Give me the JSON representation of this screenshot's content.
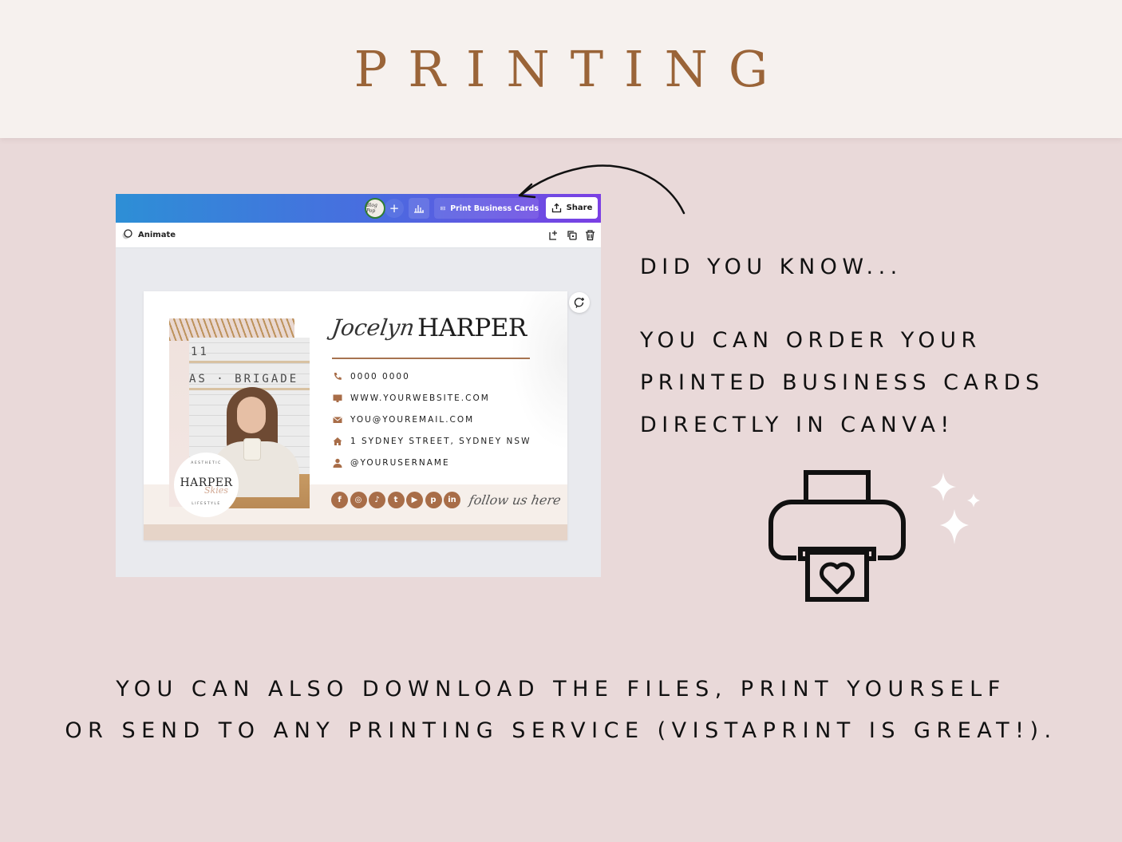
{
  "page": {
    "title": "PRINTING",
    "colors": {
      "header_bg": "#f6f1ee",
      "page_bg": "#e9d9d9",
      "title_color": "#9a6438",
      "accent_brown": "#a86d48",
      "canva_gradient_start": "#2d8fd6",
      "canva_gradient_end": "#7b3fe4"
    }
  },
  "canva": {
    "avatar_label": "Blog Pop",
    "add_icon": "plus-icon",
    "stats_icon": "bar-chart-icon",
    "print_button_label": "Print Business Cards",
    "print_button_icon": "business-card-icon",
    "share_button_label": "Share",
    "share_button_icon": "upload-icon",
    "toolbar": {
      "animate_label": "Animate",
      "animate_icon": "animate-icon",
      "icons": [
        "add-page-icon",
        "duplicate-page-icon",
        "trash-icon"
      ]
    },
    "refresh_icon": "regenerate-icon"
  },
  "business_card": {
    "first_name": "Jocelyn",
    "last_name": "HARPER",
    "photo_sign_top": "11",
    "photo_sign_bottom": "AS · BRIGADE",
    "logo": {
      "top_arc": "AESTHETIC",
      "main": "HARPER",
      "script": "Skies",
      "bottom_arc": "LIFESTYLE"
    },
    "contacts": [
      {
        "icon": "phone-icon",
        "text": "0000 0000"
      },
      {
        "icon": "monitor-icon",
        "text": "WWW.YOURWEBSITE.COM"
      },
      {
        "icon": "mail-icon",
        "text": "YOU@YOUREMAIL.COM"
      },
      {
        "icon": "home-icon",
        "text": "1 SYDNEY STREET, SYDNEY NSW"
      },
      {
        "icon": "user-icon",
        "text": "@YOURUSERNAME"
      }
    ],
    "socials": [
      {
        "icon": "facebook-icon",
        "glyph": "f"
      },
      {
        "icon": "instagram-icon",
        "glyph": "◎"
      },
      {
        "icon": "tiktok-icon",
        "glyph": "♪"
      },
      {
        "icon": "twitter-icon",
        "glyph": "t"
      },
      {
        "icon": "youtube-icon",
        "glyph": "▶"
      },
      {
        "icon": "pinterest-icon",
        "glyph": "p"
      },
      {
        "icon": "linkedin-icon",
        "glyph": "in"
      }
    ],
    "follow_text": "follow us here"
  },
  "info": {
    "did_you_know": "DID YOU KNOW...",
    "order_lines": [
      "YOU CAN ORDER YOUR",
      "PRINTED BUSINESS CARDS",
      "DIRECTLY IN CANVA!"
    ],
    "printer_icon": "printer-heart-icon",
    "sparkle_icon": "sparkles-icon"
  },
  "bottom": {
    "lines": [
      "YOU CAN ALSO DOWNLOAD THE FILES, PRINT YOURSELF",
      "OR SEND TO ANY PRINTING SERVICE (VISTAPRINT IS GREAT!)."
    ]
  }
}
